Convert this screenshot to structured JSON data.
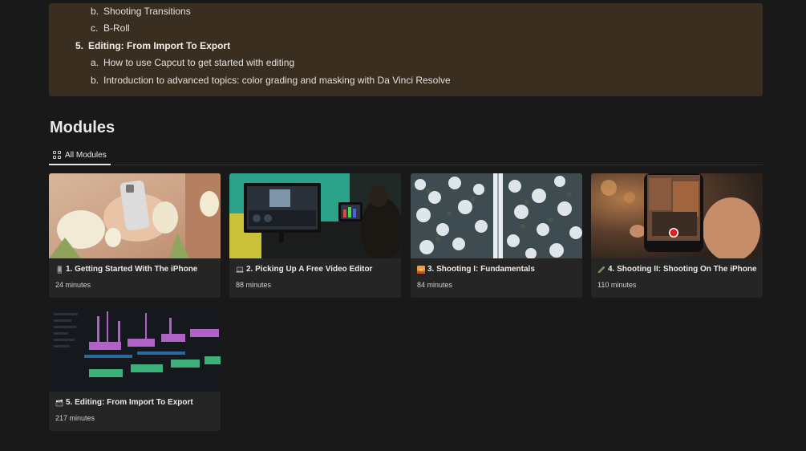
{
  "outline": [
    {
      "marker": "b.",
      "text": "Shooting Transitions",
      "bold": false
    },
    {
      "marker": "c.",
      "text": "B-Roll",
      "bold": false
    },
    {
      "marker": "5.",
      "text": "Editing: From Import To Export",
      "bold": true
    },
    {
      "marker": "a.",
      "text": "How to use Capcut to get started with editing",
      "bold": false
    },
    {
      "marker": "b.",
      "text": "Introduction to advanced topics: color grading and masking with Da Vinci Resolve",
      "bold": false
    }
  ],
  "section": {
    "heading": "Modules"
  },
  "tabs": [
    {
      "label": "All Modules",
      "icon": "grid-icon"
    }
  ],
  "modules": [
    {
      "emoji": "mobile-phone-icon",
      "title": "1. Getting Started With The iPhone",
      "duration": "24 minutes"
    },
    {
      "emoji": "laptop-icon",
      "title": "2. Picking Up A Free Video Editor",
      "duration": "88 minutes"
    },
    {
      "emoji": "sunrise-icon",
      "title": "3. Shooting I: Fundamentals",
      "duration": "84 minutes"
    },
    {
      "emoji": "pen-icon",
      "title": "4. Shooting II: Shooting On The iPhone",
      "duration": "110 minutes"
    },
    {
      "emoji": "clapper-board-icon",
      "title": "5. Editing: From Import To Export",
      "duration": "217 minutes"
    }
  ]
}
